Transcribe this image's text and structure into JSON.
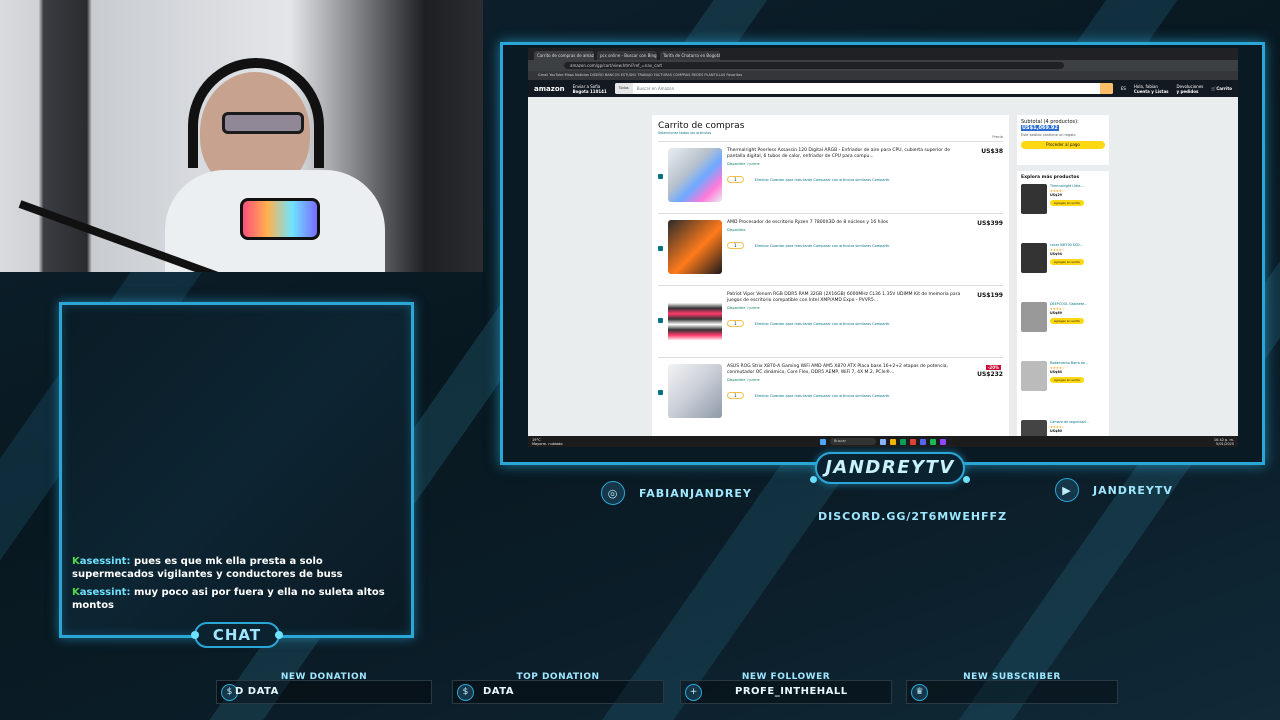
{
  "browser": {
    "tabs": [
      "Carrito de compras de amazon",
      "pcs online - Buscar con Bing",
      "Tarifa de Chatarra en Bogotá"
    ],
    "address": "amazon.com/gp/cart/view.html?ref_=nav_cart",
    "bookmarks": "Gmail   YouTube   Maps   Noticias   DISEÑO   BANCOS   ESTUDIO   TRABAJO   FACTURAS   COMPRAS   REDES   PLANTILLAS   Favoritos"
  },
  "amazon": {
    "logo": "amazon",
    "deliver_line1": "Enviar a Sofia",
    "deliver_line2": "Bogota 110141",
    "search_category": "Todos",
    "search_placeholder": "Buscar en Amazon",
    "lang": "ES",
    "account_line1": "Hola, fabian",
    "account_line2": "Cuenta y Listas",
    "orders_line1": "Devoluciones",
    "orders_line2": "y pedidos",
    "cart_label": "Carrito",
    "cart_title": "Carrito de compras",
    "cart_sub": "Seleccionar todos los artículos",
    "price_header": "Precio",
    "items": [
      {
        "name": "Thermalright Peerless Assassin 120 Digital ARGB - Enfriador de aire para CPU, cubierta superior de pantalla digital, 6 tubos de calor, enfriador de CPU para compu...",
        "meta": "Disponible  ✓prime",
        "qty": "1",
        "actions": "Eliminar   Guardar para más tarde   Comparar con artículos similares   Compartir",
        "price": "US$38",
        "discount": ""
      },
      {
        "name": "AMD Procesador de escritorio Ryzen 7 7800X3D de 8 núcleos y 16 hilos",
        "meta": "Disponible",
        "qty": "1",
        "actions": "Eliminar   Guardar para más tarde   Comparar con artículos similares   Compartir",
        "price": "US$399",
        "discount": ""
      },
      {
        "name": "Patriot Viper Venom RGB DDR5 RAM 32GB (2X16GB) 6000MHz CL36 1.35V UDIMM Kit de memoria para juegos de escritorio compatible con Intel XMP/AMD Expo - PVVR5...",
        "meta": "Disponible  ✓prime",
        "qty": "1",
        "actions": "Eliminar   Guardar para más tarde   Comparar con artículos similares   Compartir",
        "price": "US$199",
        "discount": ""
      },
      {
        "name": "ASUS ROG Strix X870-A Gaming WiFi AMD AM5 X870 ATX Placa base 16+2+2 etapas de potencia, conmutador OC dinámico, Core Flex, DDR5 AEMP, WiFi 7, 4X M.2, PCIe®...",
        "meta": "Disponible  ✓prime",
        "qty": "1",
        "actions": "Eliminar   Guardar para más tarde   Comparar con artículos similares   Compartir",
        "price": "US$232",
        "discount": "-20%"
      }
    ],
    "subtotal_label": "Subtotal (4 productos):",
    "subtotal_amount": "US$1,069.92",
    "gift_label": "Este pedido contiene un regalo",
    "checkout": "Proceder al pago",
    "explore_title": "Explora más productos",
    "explore_items": [
      {
        "name": "Thermalright Ultra...",
        "stars": "★★★★☆",
        "price": "US$29",
        "btn": "Agregar al carrito"
      },
      {
        "name": "Lexar NM790 SSD...",
        "stars": "★★★★☆",
        "price": "US$94",
        "btn": "Agregar al carrito"
      },
      {
        "name": "DEEPCOOL Gabinete...",
        "stars": "★★★★☆",
        "price": "US$69",
        "btn": "Agregar al carrito"
      },
      {
        "name": "Rodamiento Barra de...",
        "stars": "★★★★☆",
        "price": "US$64",
        "btn": "Agregar al carrito"
      },
      {
        "name": "Cámara de seguridad...",
        "stars": "★★★★☆",
        "price": "US$80",
        "btn": "Agregar al carrito"
      }
    ]
  },
  "taskbar": {
    "weather_line1": "19°C",
    "weather_line2": "Mayorm. nublado",
    "search": "Buscar",
    "time_line1": "10:42 p. m.",
    "time_line2": "5/01/2025"
  },
  "chat": {
    "tab_label": "CHAT",
    "messages": [
      {
        "user": "asessint",
        "text": "pues es que mk ella presta a solo supermecados vigilantes y conductores de buss"
      },
      {
        "user": "asessint",
        "text": "muy poco asi por fuera y ella no suleta altos montos"
      }
    ]
  },
  "overlay": {
    "streamer_name": "JANDREYTV",
    "instagram": "FABIANJANDREY",
    "youtube": "JANDREYTV",
    "discord": "DISCORD.GG/2T6MWEHFFZ",
    "alerts": [
      {
        "label": "NEW DONATION",
        "value": "D DATA",
        "icon": "$"
      },
      {
        "label": "TOP DONATION",
        "value": "DATA",
        "icon": "$"
      },
      {
        "label": "NEW FOLLOWER",
        "value": "PROFE_INTHEHALL",
        "icon": "+"
      },
      {
        "label": "NEW SUBSCRIBER",
        "value": "",
        "icon": "♛"
      }
    ]
  },
  "colors": {
    "accent": "#2aa7d6",
    "accent_light": "#9fe6ff",
    "background": "#0b1d28"
  }
}
